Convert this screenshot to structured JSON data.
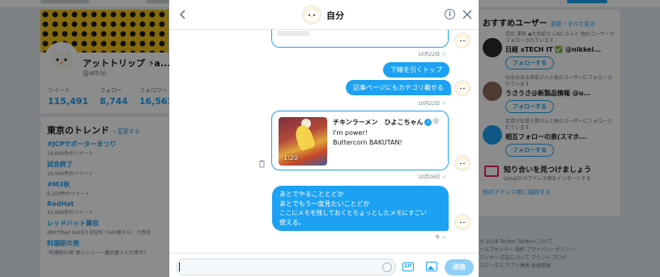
{
  "profile": {
    "name": "アットトリップ ⚡a...",
    "handle": "@attrip",
    "stats": [
      {
        "label": "ツイート",
        "value": "115,491"
      },
      {
        "label": "フォロー",
        "value": "8,744"
      },
      {
        "label": "フォロワー",
        "value": "16,562"
      }
    ]
  },
  "trends": {
    "title": "東京のトレンド",
    "change": "・変更する",
    "items": [
      {
        "name": "#JCPサポーターまつり",
        "sub": "18,800件のツイート"
      },
      {
        "name": "試合終了",
        "sub": "16,540件のツイート"
      },
      {
        "name": "#M3秋",
        "sub": "6,200件のツイート"
      },
      {
        "name": "RedHat",
        "sub": "42,898件のツイート"
      },
      {
        "name": "レッドハット買収",
        "sub": "IBMがRed Hatを3.8兆円（340億ドル）で買収"
      },
      {
        "name": "料理研の男",
        "sub": "\"料理研の男\"君ジャニー・藤沢書さんが斉が？"
      }
    ]
  },
  "recommend": {
    "title": "おすすめユーザー",
    "links": "更新・すべて見る",
    "users": [
      {
        "note": "日比 運用 ◆九世紀の CAD さんと 他のユーザーがフォローされています",
        "name": "日経 xTECH IT ✅ @nikkei...",
        "button": "フォローする"
      },
      {
        "note": "元水分出る名前さんと他のユーザーにフォローされています",
        "name": "うさうさ@新製品情報 @u...",
        "button": "フォローする"
      },
      {
        "note": "足資が仕掛人勢さんと他のユーザーにフォローされています",
        "name": "相互フォローの泉(スマホ...",
        "button": "フォローする"
      }
    ],
    "find_title": "知り合いを見つけましょう",
    "find_sub": "Gmailからアドレス帳をインポートする",
    "more": "他のアドレス帳に接続する"
  },
  "footer": {
    "lines": [
      "© 2018 Twitter  Twitterについて",
      "ヘルプセンター  規約  プライバシーポリシー",
      "クッキー  広告について  ブランド  ブログ",
      "ステータス  アプリ連携  採用情報"
    ]
  },
  "dm": {
    "title": "自分",
    "messages": [
      {
        "text": "",
        "time": "10月22日",
        "check": "✓"
      },
      {
        "text": "下線を引くトップ",
        "time": "",
        "check": ""
      },
      {
        "text": "記事ページにもカテゴリ載せる",
        "time": "10月22日",
        "check": "✓"
      },
      {
        "text": "",
        "time": "10月26日",
        "check": "✓"
      },
      {
        "text": "",
        "time": "今",
        "check": "✓"
      }
    ],
    "tweet": {
      "author": "チキンラーメン　ひよこちゃん",
      "handle": "@",
      "lines": [
        "I'm power!",
        "Buttercorn BAKUTAN!"
      ],
      "duration": "1:20"
    },
    "long_message": [
      "あとでやることとどか",
      "あとでもう一度見たいことどか",
      "ここにメモを残しておくとちょっとしたメモにすごい",
      "使える。"
    ],
    "compose_placeholder": "",
    "gif_label": "GIF",
    "send_label": "送信"
  },
  "icons": [
    "back-arrow-icon",
    "info-icon",
    "close-icon",
    "trash-icon",
    "emoji-icon",
    "gif-icon",
    "image-icon",
    "verified-icon"
  ],
  "colors": {
    "accent": "#1da1f2",
    "bubble_text": "#ffffff",
    "muted": "#657786"
  }
}
